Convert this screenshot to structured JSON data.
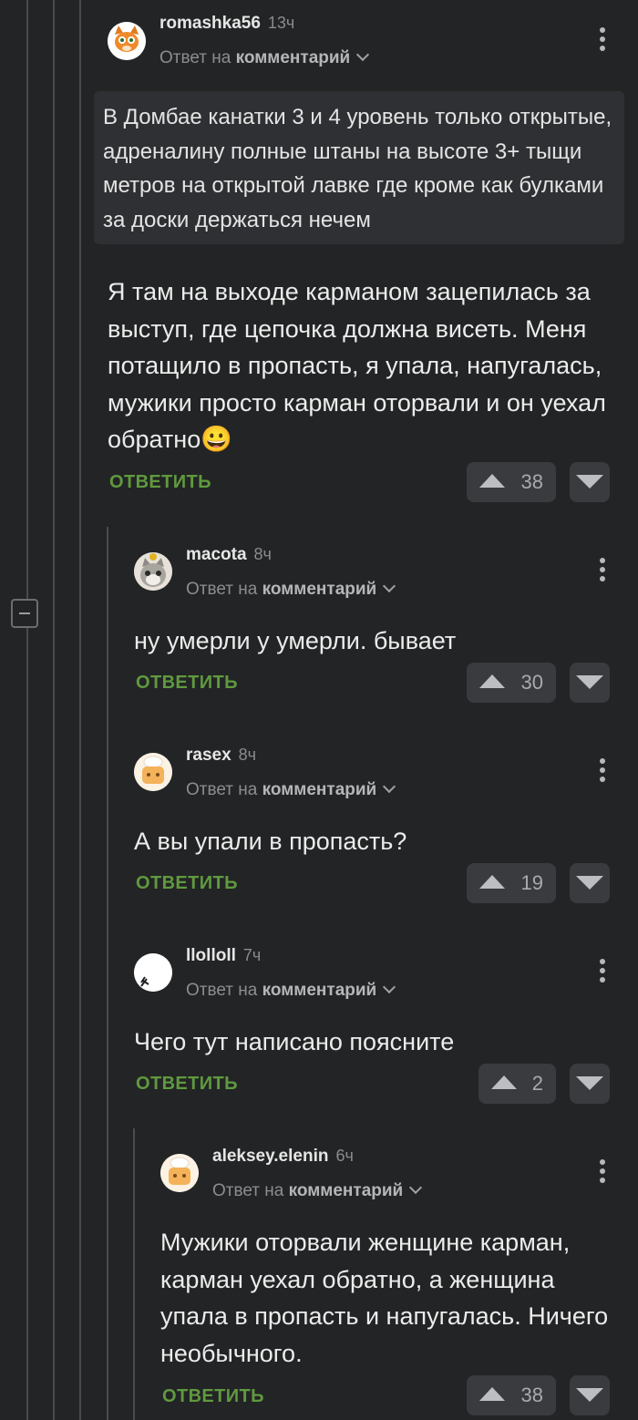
{
  "comments": [
    {
      "author": "romashka56",
      "time": "13ч",
      "reply_prefix": "Ответ на",
      "reply_target": "комментарий",
      "quote": "В Домбае канатки 3 и 4 уровень только открытые, адреналину полные штаны на высоте 3+ тыщи метров на открытой лавке где кроме как булками за доски держаться нечем",
      "text": "Я там на выходе карманом зацепилась за выступ, где цепочка должна висеть. Меня потащило в пропасть, я упала, напугалась, мужики просто карман оторвали и он уехал обратно",
      "emoji": "😀",
      "reply_label": "ОТВЕТИТЬ",
      "rating": "38"
    },
    {
      "author": "macota",
      "time": "8ч",
      "reply_prefix": "Ответ на",
      "reply_target": "комментарий",
      "text": "ну умерли у умерли. бывает",
      "reply_label": "ОТВЕТИТЬ",
      "rating": "30"
    },
    {
      "author": "rasex",
      "time": "8ч",
      "reply_prefix": "Ответ на",
      "reply_target": "комментарий",
      "text": "А вы упали в пропасть?",
      "reply_label": "ОТВЕТИТЬ",
      "rating": "19"
    },
    {
      "author": "llolloll",
      "time": "7ч",
      "reply_prefix": "Ответ на",
      "reply_target": "комментарий",
      "text": "Чего тут написано поясните",
      "reply_label": "ОТВЕТИТЬ",
      "rating": "2"
    },
    {
      "author": "aleksey.elenin",
      "time": "6ч",
      "reply_prefix": "Ответ на",
      "reply_target": "комментарий",
      "text": "Мужики оторвали женщине карман, карман уехал обратно, а женщина упала в пропасть и напугалась. Ничего необычного.",
      "reply_label": "ОТВЕТИТЬ",
      "rating": "38"
    }
  ],
  "colors": {
    "background": "#232425",
    "reply_accent": "#5f9a3f",
    "vote_bg": "#3a3b3e"
  }
}
